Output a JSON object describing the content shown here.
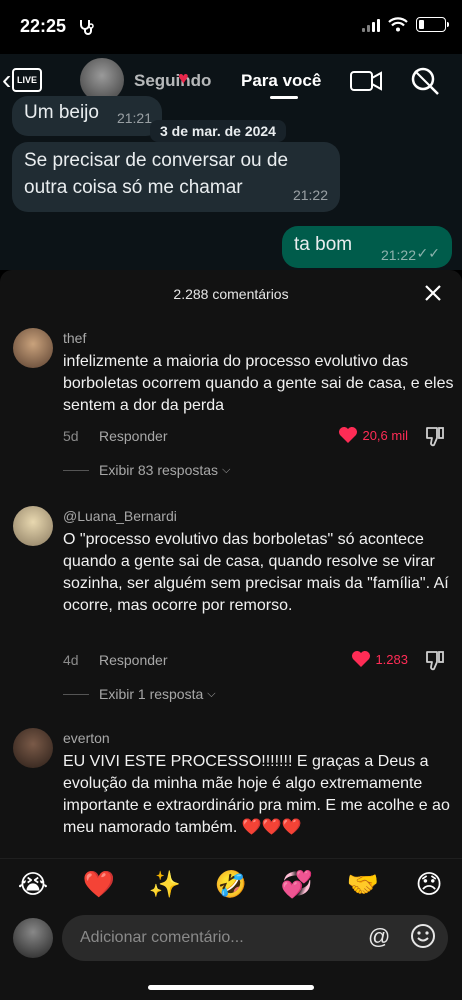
{
  "status_bar": {
    "time": "22:25"
  },
  "top_nav": {
    "live_label": "LIVE",
    "following_label": "Seguindo",
    "for_you_label": "Para você"
  },
  "chat": {
    "messages": [
      {
        "text": "Um beijo",
        "time": "21:21",
        "direction": "in"
      },
      {
        "text": "Se precisar de conversar ou de outra coisa só me chamar",
        "time": "21:22",
        "direction": "in"
      },
      {
        "text": "ta bom",
        "time": "21:22",
        "direction": "out"
      }
    ],
    "date_chip": "3 de mar. de 2024"
  },
  "comments_sheet": {
    "count_label": "2.288 comentários",
    "comments": [
      {
        "username": "thef",
        "text": "infelizmente a maioria do processo evolutivo das borboletas ocorrem quando a gente sai de casa, e eles sentem a dor da perda",
        "age": "5d",
        "reply_label": "Responder",
        "likes": "20,6 mil",
        "view_replies": "Exibir 83 respostas"
      },
      {
        "username": "@Luana_Bernardi",
        "text": "O \"processo evolutivo das borboletas\" só acontece quando a gente sai de casa, quando resolve se virar sozinha, ser alguém sem precisar mais da \"família\". Aí ocorre, mas ocorre por remorso.",
        "age": "4d",
        "reply_label": "Responder",
        "likes": "1.283",
        "view_replies": "Exibir 1 resposta"
      },
      {
        "username": "everton",
        "text": "EU VIVI ESTE PROCESSO!!!!!!! E graças a Deus a evolução da minha mãe hoje é algo extremamente importante e extraordinário pra mim. E me acolhe e ao meu namorado também. ❤️❤️❤️"
      }
    ]
  },
  "emoji_bar": [
    "😭",
    "❤️",
    "✨",
    "🤣",
    "💞",
    "🤝",
    "😞"
  ],
  "comment_input": {
    "placeholder": "Adicionar comentário..."
  },
  "colors": {
    "like_red": "#fe2c55",
    "sheet_bg": "#121212",
    "out_bubble": "#005c4b",
    "in_bubble": "#202c33"
  }
}
